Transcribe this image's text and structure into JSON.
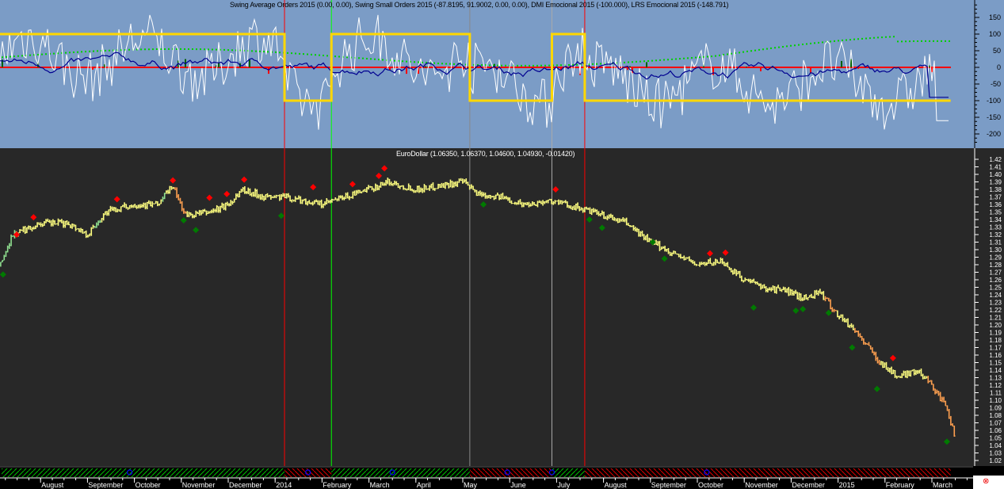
{
  "indicator_title": "Swing Average Orders 2015 (0.00, 0.00), Swing Small Orders 2015 (-87.8195, 91.9002, 0.00, 0.00), DMI Emocional 2015 (-100.000), LRS Emocional 2015 (-148.791)",
  "price_title": "EuroDollar (1.06350, 1.06370, 1.04600, 1.04930, -0.01420)",
  "corner_icon": "close-circle-icon",
  "colors": {
    "top_bg": "#7b9cc6",
    "bottom_bg": "#282828",
    "bar": "#ffff80",
    "buy": "#007a00",
    "sell": "#ff0000",
    "step": "#ffd700",
    "long_band": "#00c000",
    "short_band": "#e00000"
  },
  "chart_data": [
    {
      "type": "line",
      "title": "Swing Average Orders 2015 / Swing Small Orders 2015 / DMI Emocional 2015 / LRS Emocional 2015",
      "ylim": [
        -230,
        200
      ],
      "yticks": [
        150,
        100,
        50,
        0,
        -50,
        -100,
        -150,
        -200
      ],
      "step_signal": [
        {
          "from": 0,
          "to": 6.2,
          "value": 100
        },
        {
          "from": 6.2,
          "to": 7.2,
          "value": -100
        },
        {
          "from": 7.2,
          "to": 10.15,
          "value": 100
        },
        {
          "from": 10.15,
          "to": 11.9,
          "value": -100
        },
        {
          "from": 11.9,
          "to": 12.6,
          "value": 100
        },
        {
          "from": 12.6,
          "to": 20.4,
          "value": -100
        }
      ],
      "last_values": {
        "swing_small_orders": -87.8195,
        "dmi": -100,
        "lrs": -148.791
      }
    },
    {
      "type": "line",
      "title": "EuroDollar",
      "ylim": [
        1.02,
        1.42
      ],
      "yticks": [
        "1.42",
        "1.41",
        "1.40",
        "1.39",
        "1.38",
        "1.37",
        "1.36",
        "1.35",
        "1.34",
        "1.33",
        "1.32",
        "1.31",
        "1.30",
        "1.29",
        "1.28",
        "1.27",
        "1.26",
        "1.25",
        "1.24",
        "1.23",
        "1.22",
        "1.21",
        "1.20",
        "1.19",
        "1.18",
        "1.17",
        "1.16",
        "1.15",
        "1.14",
        "1.13",
        "1.12",
        "1.11",
        "1.10",
        "1.09",
        "1.08",
        "1.07",
        "1.06",
        "1.05",
        "1.04",
        "1.03",
        "1.02"
      ],
      "xticks": [
        "August",
        "September",
        "October",
        "November",
        "December",
        "2014",
        "February",
        "March",
        "April",
        "May",
        "June",
        "July",
        "August",
        "September",
        "October",
        "November",
        "December",
        "2015",
        "February",
        "March"
      ],
      "price_path": [
        [
          0.15,
          1.28
        ],
        [
          0.4,
          1.32
        ],
        [
          1,
          1.335
        ],
        [
          1.6,
          1.335
        ],
        [
          2,
          1.32
        ],
        [
          2.4,
          1.35
        ],
        [
          3,
          1.36
        ],
        [
          3.5,
          1.36
        ],
        [
          3.8,
          1.385
        ],
        [
          4.1,
          1.345
        ],
        [
          4.6,
          1.35
        ],
        [
          5,
          1.36
        ],
        [
          5.3,
          1.38
        ],
        [
          5.8,
          1.37
        ],
        [
          6.2,
          1.37
        ],
        [
          6.6,
          1.365
        ],
        [
          7,
          1.36
        ],
        [
          7.5,
          1.37
        ],
        [
          8,
          1.38
        ],
        [
          8.4,
          1.39
        ],
        [
          9,
          1.38
        ],
        [
          9.5,
          1.385
        ],
        [
          10,
          1.39
        ],
        [
          10.3,
          1.375
        ],
        [
          10.8,
          1.37
        ],
        [
          11.3,
          1.36
        ],
        [
          11.9,
          1.365
        ],
        [
          12.5,
          1.355
        ],
        [
          13,
          1.345
        ],
        [
          13.5,
          1.335
        ],
        [
          14,
          1.31
        ],
        [
          14.5,
          1.295
        ],
        [
          15,
          1.28
        ],
        [
          15.5,
          1.285
        ],
        [
          16,
          1.26
        ],
        [
          16.4,
          1.25
        ],
        [
          16.9,
          1.245
        ],
        [
          17.3,
          1.235
        ],
        [
          17.6,
          1.245
        ],
        [
          17.9,
          1.22
        ],
        [
          18.4,
          1.19
        ],
        [
          18.9,
          1.15
        ],
        [
          19.3,
          1.13
        ],
        [
          19.6,
          1.14
        ],
        [
          19.9,
          1.13
        ],
        [
          20.3,
          1.09
        ],
        [
          20.5,
          1.05
        ]
      ],
      "sell_markers": [
        [
          0.49,
          1.32
        ],
        [
          0.85,
          1.343
        ],
        [
          2.63,
          1.367
        ],
        [
          3.82,
          1.392
        ],
        [
          4.6,
          1.369
        ],
        [
          4.97,
          1.374
        ],
        [
          5.34,
          1.393
        ],
        [
          6.81,
          1.383
        ],
        [
          7.65,
          1.387
        ],
        [
          8.21,
          1.398
        ],
        [
          8.33,
          1.408
        ],
        [
          11.98,
          1.38
        ],
        [
          15.27,
          1.295
        ],
        [
          15.6,
          1.296
        ],
        [
          19.17,
          1.156
        ]
      ],
      "buy_markers": [
        [
          0.2,
          1.267
        ],
        [
          4.05,
          1.339
        ],
        [
          4.31,
          1.326
        ],
        [
          6.13,
          1.345
        ],
        [
          10.44,
          1.36
        ],
        [
          12.7,
          1.34
        ],
        [
          12.97,
          1.329
        ],
        [
          14.05,
          1.31
        ],
        [
          14.3,
          1.288
        ],
        [
          16.2,
          1.223
        ],
        [
          17.1,
          1.219
        ],
        [
          17.25,
          1.221
        ],
        [
          17.8,
          1.216
        ],
        [
          18.3,
          1.17
        ],
        [
          18.83,
          1.115
        ],
        [
          20.32,
          1.045
        ]
      ]
    }
  ]
}
